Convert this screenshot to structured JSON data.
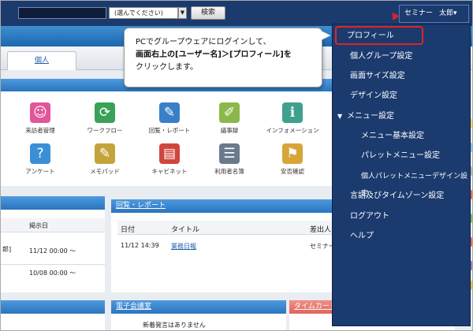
{
  "topbar": {
    "select_value": "(選んでください)",
    "search_button": "検索",
    "user_first": "セミナー",
    "user_last": "太郎",
    "user_caret": "▾"
  },
  "tabs": {
    "kojin": "個人"
  },
  "apps": [
    {
      "label": "来訪者管理",
      "icon": "visitor-icon",
      "color": "#e2559a",
      "glyph": "☺"
    },
    {
      "label": "ワークフロー",
      "icon": "workflow-icon",
      "color": "#3aa257",
      "glyph": "⟳"
    },
    {
      "label": "回覧・レポート",
      "icon": "report-icon",
      "color": "#3b7fc8",
      "glyph": "✎"
    },
    {
      "label": "議事録",
      "icon": "minutes-icon",
      "color": "#8bb84a",
      "glyph": "✐"
    },
    {
      "label": "インフォメーション",
      "icon": "information-icon",
      "color": "#3fa08e",
      "glyph": "ℹ"
    },
    {
      "label": "アンケート",
      "icon": "survey-icon",
      "color": "#3b8fd6",
      "glyph": "?"
    },
    {
      "label": "メモパッド",
      "icon": "memopad-icon",
      "color": "#c4a43a",
      "glyph": "✎"
    },
    {
      "label": "キャビネット",
      "icon": "cabinet-icon",
      "color": "#d0463e",
      "glyph": "▤"
    },
    {
      "label": "利用者名簿",
      "icon": "directory-icon",
      "color": "#6a7a8c",
      "glyph": "☰"
    },
    {
      "label": "安否確認",
      "icon": "safety-icon",
      "color": "#d9a53a",
      "glyph": "⚑"
    }
  ],
  "left_table": {
    "header": "掲示日",
    "rows": [
      {
        "prefix": "郎]",
        "date": "11/12 00:00 ～"
      },
      {
        "prefix": "",
        "date": "10/08 00:00 ～"
      }
    ]
  },
  "report_pane": {
    "title": "回覧・レポート",
    "col_date": "日付",
    "col_title": "タイトル",
    "col_sender": "差出人",
    "row_date": "11/12 14:39",
    "row_title": "業務日報",
    "row_sender": "セミナー"
  },
  "bottom": {
    "meeting": "電子会議室",
    "meeting_note": "新着発言はありません",
    "timecard": "タイムカード"
  },
  "callout": {
    "line1": "PCでグループウェアにログインして、",
    "line2": "画面右上の[ユーザー名]＞[プロフィール]を",
    "line3": "クリックします。"
  },
  "menu": {
    "items": [
      "プロフィール",
      "個人グループ設定",
      "画面サイズ設定",
      "デザイン設定",
      "メニュー設定",
      "メニュー基本設定",
      "パレットメニュー設定",
      "個人パレットメニューデザイン設定",
      "言語及びタイムゾーン設定",
      "ログアウト",
      "ヘルプ"
    ]
  },
  "colors": {
    "topbar": "#1b3b6f",
    "menu_bg": "#1b3b6f",
    "highlight": "#e02424",
    "accent_blue": "#2a74bf",
    "timecard_head": "#e8736b"
  }
}
